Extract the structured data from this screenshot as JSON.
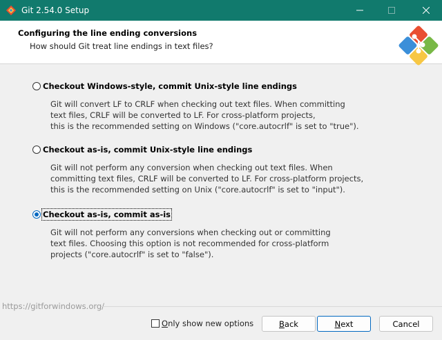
{
  "window": {
    "title": "Git 2.54.0 Setup",
    "accent_color": "#117a6d"
  },
  "header": {
    "title": "Configuring the line ending conversions",
    "subtitle": "How should Git treat line endings in text files?"
  },
  "options": [
    {
      "label": "Checkout Windows-style, commit Unix-style line endings",
      "selected": false,
      "description": [
        "Git will convert LF to CRLF when checking out text files. When committing",
        "text files, CRLF will be converted to LF. For cross-platform projects,",
        "this is the recommended setting on Windows (\"core.autocrlf\" is set to \"true\")."
      ]
    },
    {
      "label": "Checkout as-is, commit Unix-style line endings",
      "selected": false,
      "description": [
        "Git will not perform any conversion when checking out text files. When",
        "committing text files, CRLF will be converted to LF. For cross-platform projects,",
        "this is the recommended setting on Unix (\"core.autocrlf\" is set to \"input\")."
      ]
    },
    {
      "label": "Checkout as-is, commit as-is",
      "selected": true,
      "description": [
        "Git will not perform any conversions when checking out or committing",
        "text files. Choosing this option is not recommended for cross-platform",
        "projects (\"core.autocrlf\" is set to \"false\")."
      ]
    }
  ],
  "footer": {
    "link": "https://gitforwindows.org/",
    "checkbox_label_first": "O",
    "checkbox_label_rest": "nly show new options",
    "checkbox_checked": false,
    "back_first": "B",
    "back_rest": "ack",
    "next_first": "N",
    "next_rest": "ext",
    "cancel_label": "Cancel"
  }
}
